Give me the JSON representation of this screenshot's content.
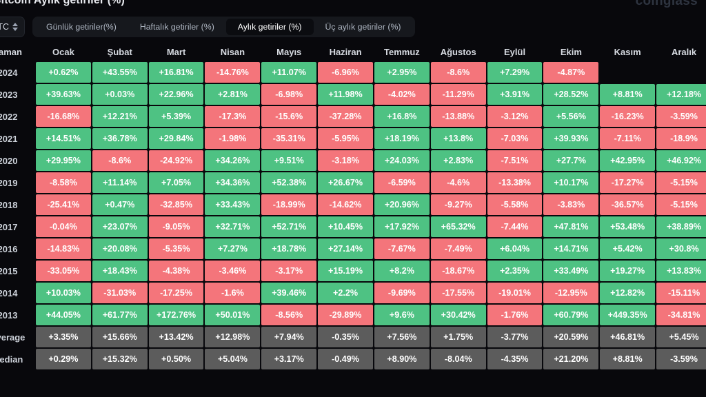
{
  "header": {
    "title": "Bitcoin Aylık getiriler (%)",
    "watermark": "coinglass"
  },
  "controls": {
    "symbol": "BTC",
    "symbol_icon": "chevron-up-down-icon",
    "tabs": [
      {
        "label": "Günlük getiriler(%)",
        "active": false
      },
      {
        "label": "Haftalık getiriler (%)",
        "active": false
      },
      {
        "label": "Aylık getiriler (%)",
        "active": true
      },
      {
        "label": "Üç aylık getiriler (%)",
        "active": false
      }
    ]
  },
  "colors": {
    "positive": "#4ec283",
    "negative": "#f4757b",
    "neutral": "#5c5c5c",
    "background": "#08080c"
  },
  "table": {
    "columns": [
      "Zaman",
      "Ocak",
      "Şubat",
      "Mart",
      "Nisan",
      "Mayıs",
      "Haziran",
      "Temmuz",
      "Ağustos",
      "Eylül",
      "Ekim",
      "Kasım",
      "Aralık"
    ],
    "rows": [
      {
        "label": "2024",
        "kind": "year",
        "cells": [
          "+0.62%",
          "+43.55%",
          "+16.81%",
          "-14.76%",
          "+11.07%",
          "-6.96%",
          "+2.95%",
          "-8.6%",
          "+7.29%",
          "-4.87%",
          "",
          ""
        ]
      },
      {
        "label": "2023",
        "kind": "year",
        "cells": [
          "+39.63%",
          "+0.03%",
          "+22.96%",
          "+2.81%",
          "-6.98%",
          "+11.98%",
          "-4.02%",
          "-11.29%",
          "+3.91%",
          "+28.52%",
          "+8.81%",
          "+12.18%"
        ]
      },
      {
        "label": "2022",
        "kind": "year",
        "cells": [
          "-16.68%",
          "+12.21%",
          "+5.39%",
          "-17.3%",
          "-15.6%",
          "-37.28%",
          "+16.8%",
          "-13.88%",
          "-3.12%",
          "+5.56%",
          "-16.23%",
          "-3.59%"
        ]
      },
      {
        "label": "2021",
        "kind": "year",
        "cells": [
          "+14.51%",
          "+36.78%",
          "+29.84%",
          "-1.98%",
          "-35.31%",
          "-5.95%",
          "+18.19%",
          "+13.8%",
          "-7.03%",
          "+39.93%",
          "-7.11%",
          "-18.9%"
        ]
      },
      {
        "label": "2020",
        "kind": "year",
        "cells": [
          "+29.95%",
          "-8.6%",
          "-24.92%",
          "+34.26%",
          "+9.51%",
          "-3.18%",
          "+24.03%",
          "+2.83%",
          "-7.51%",
          "+27.7%",
          "+42.95%",
          "+46.92%"
        ]
      },
      {
        "label": "2019",
        "kind": "year",
        "cells": [
          "-8.58%",
          "+11.14%",
          "+7.05%",
          "+34.36%",
          "+52.38%",
          "+26.67%",
          "-6.59%",
          "-4.6%",
          "-13.38%",
          "+10.17%",
          "-17.27%",
          "-5.15%"
        ]
      },
      {
        "label": "2018",
        "kind": "year",
        "cells": [
          "-25.41%",
          "+0.47%",
          "-32.85%",
          "+33.43%",
          "-18.99%",
          "-14.62%",
          "+20.96%",
          "-9.27%",
          "-5.58%",
          "-3.83%",
          "-36.57%",
          "-5.15%"
        ]
      },
      {
        "label": "2017",
        "kind": "year",
        "cells": [
          "-0.04%",
          "+23.07%",
          "-9.05%",
          "+32.71%",
          "+52.71%",
          "+10.45%",
          "+17.92%",
          "+65.32%",
          "-7.44%",
          "+47.81%",
          "+53.48%",
          "+38.89%"
        ]
      },
      {
        "label": "2016",
        "kind": "year",
        "cells": [
          "-14.83%",
          "+20.08%",
          "-5.35%",
          "+7.27%",
          "+18.78%",
          "+27.14%",
          "-7.67%",
          "-7.49%",
          "+6.04%",
          "+14.71%",
          "+5.42%",
          "+30.8%"
        ]
      },
      {
        "label": "2015",
        "kind": "year",
        "cells": [
          "-33.05%",
          "+18.43%",
          "-4.38%",
          "-3.46%",
          "-3.17%",
          "+15.19%",
          "+8.2%",
          "-18.67%",
          "+2.35%",
          "+33.49%",
          "+19.27%",
          "+13.83%"
        ]
      },
      {
        "label": "2014",
        "kind": "year",
        "cells": [
          "+10.03%",
          "-31.03%",
          "-17.25%",
          "-1.6%",
          "+39.46%",
          "+2.2%",
          "-9.69%",
          "-17.55%",
          "-19.01%",
          "-12.95%",
          "+12.82%",
          "-15.11%"
        ]
      },
      {
        "label": "2013",
        "kind": "year",
        "cells": [
          "+44.05%",
          "+61.77%",
          "+172.76%",
          "+50.01%",
          "-8.56%",
          "-29.89%",
          "+9.6%",
          "+30.42%",
          "-1.76%",
          "+60.79%",
          "+449.35%",
          "-34.81%"
        ]
      },
      {
        "label": "Average",
        "kind": "stat",
        "cells": [
          "+3.35%",
          "+15.66%",
          "+13.42%",
          "+12.98%",
          "+7.94%",
          "-0.35%",
          "+7.56%",
          "+1.75%",
          "-3.77%",
          "+20.59%",
          "+46.81%",
          "+5.45%"
        ]
      },
      {
        "label": "Median",
        "kind": "stat",
        "cells": [
          "+0.29%",
          "+15.32%",
          "+0.50%",
          "+5.04%",
          "+3.17%",
          "-0.49%",
          "+8.90%",
          "-8.04%",
          "-4.35%",
          "+21.20%",
          "+8.81%",
          "-3.59%"
        ]
      }
    ]
  }
}
